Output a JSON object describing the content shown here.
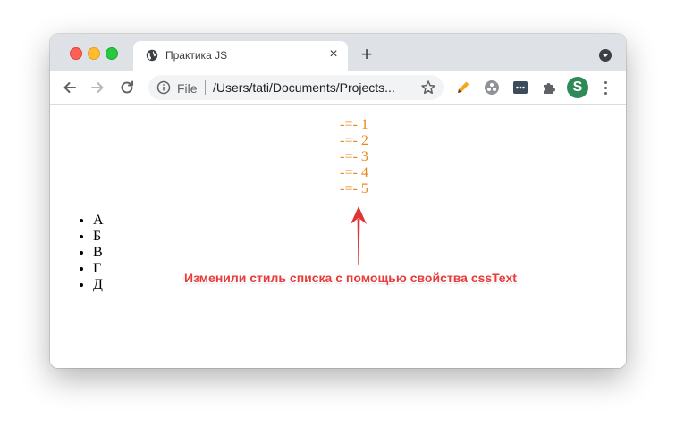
{
  "tab": {
    "title": "Практика JS",
    "close": "×",
    "new_tab": "+"
  },
  "address_bar": {
    "scheme": "File",
    "url": "/Users/tati/Documents/Projects..."
  },
  "page": {
    "styled_list": [
      "-=- 1",
      "-=- 2",
      "-=- 3",
      "-=- 4",
      "-=- 5"
    ],
    "plain_list": [
      "А",
      "Б",
      "В",
      "Г",
      "Д"
    ],
    "annotation": "Изменили стиль списка с помощью свойства cssText"
  },
  "profile": {
    "initial": "S"
  },
  "colors": {
    "styled_list": "#e8871e",
    "annotation": "#e83b3b",
    "avatar": "#2e8b57"
  },
  "icons": [
    "globe-icon",
    "close-icon",
    "plus-icon",
    "chevron-down-icon",
    "back-icon",
    "forward-icon",
    "reload-icon",
    "info-icon",
    "star-icon",
    "pencil-icon",
    "extension-icon",
    "puzzle-icon",
    "kebab-menu-icon",
    "arrow-up-icon"
  ]
}
